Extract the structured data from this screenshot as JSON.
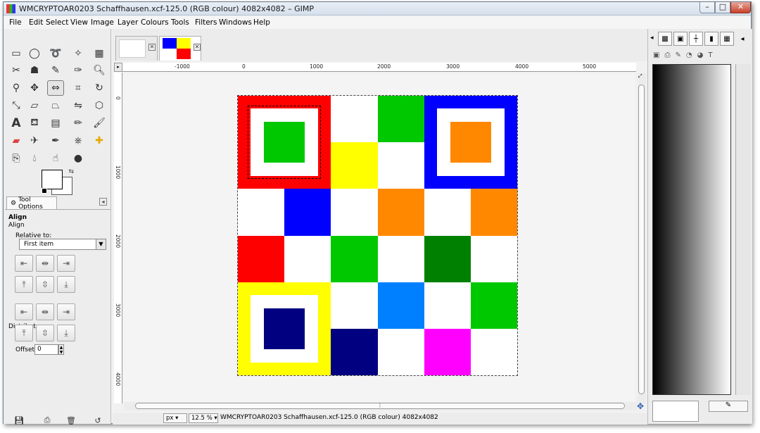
{
  "window": {
    "title": "WMCRYPTOAR0203 Schaffhausen.xcf-125.0 (RGB colour) 4082x4082 – GIMP",
    "controls": {
      "minimize": "–",
      "maximize": "□",
      "close": "✕"
    }
  },
  "menu": [
    "File",
    "Edit",
    "Select",
    "View",
    "Image",
    "Layer",
    "Colours",
    "Tools",
    "Filters",
    "Windows",
    "Help"
  ],
  "tool_options": {
    "tab_label": "Tool Options",
    "tool_name": "Align",
    "section": "Align",
    "relative_to_label": "Relative to:",
    "relative_to_value": "First item",
    "distribute_label": "Distribute",
    "offset_label": "Offset:",
    "offset_value": "0"
  },
  "rulers": {
    "top": [
      "-1000",
      "0",
      "1000",
      "2000",
      "3000",
      "4000",
      "5000"
    ],
    "left": [
      "0",
      "1000",
      "2000",
      "3000",
      "4000"
    ]
  },
  "status": {
    "unit": "px",
    "zoom": "12.5 %",
    "message": "WMCRYPTOAR0203 Schaffhausen.xcf-125.0 (RGB colour) 4082x4082"
  },
  "image_grid": {
    "rows": 6,
    "cols": 6,
    "colors": {
      "red": "#ff0000",
      "green": "#00c800",
      "blue": "#0000ff",
      "yellow": "#ffff00",
      "orange": "#ff8800",
      "darkgreen": "#008000",
      "azure": "#0080ff",
      "navy": "#000080",
      "magenta": "#ff00ff",
      "white": "#ffffff"
    }
  }
}
